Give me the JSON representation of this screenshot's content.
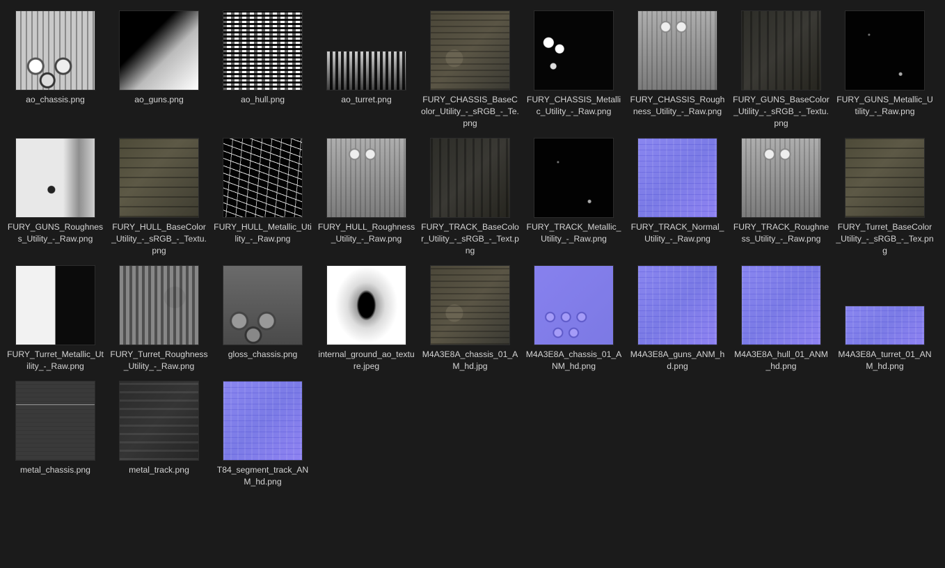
{
  "files": [
    {
      "name": "ao_chassis.png"
    },
    {
      "name": "ao_guns.png"
    },
    {
      "name": "ao_hull.png"
    },
    {
      "name": "ao_turret.png"
    },
    {
      "name": "FURY_CHASSIS_BaseColor_Utility_-_sRGB_-_Te.png"
    },
    {
      "name": "FURY_CHASSIS_Metallic_Utility_-_Raw.png"
    },
    {
      "name": "FURY_CHASSIS_Roughness_Utility_-_Raw.png"
    },
    {
      "name": "FURY_GUNS_BaseColor_Utility_-_sRGB_-_Textu.png"
    },
    {
      "name": "FURY_GUNS_Metallic_Utility_-_Raw.png"
    },
    {
      "name": "FURY_GUNS_Roughness_Utility_-_Raw.png"
    },
    {
      "name": "FURY_HULL_BaseColor_Utility_-_sRGB_-_Textu.png"
    },
    {
      "name": "FURY_HULL_Metallic_Utility_-_Raw.png"
    },
    {
      "name": "FURY_HULL_Roughness_Utility_-_Raw.png"
    },
    {
      "name": "FURY_TRACK_BaseColor_Utility_-_sRGB_-_Text.png"
    },
    {
      "name": "FURY_TRACK_Metallic_Utility_-_Raw.png"
    },
    {
      "name": "FURY_TRACK_Normal_Utility_-_Raw.png"
    },
    {
      "name": "FURY_TRACK_Roughness_Utility_-_Raw.png"
    },
    {
      "name": "FURY_Turret_BaseColor_Utility_-_sRGB_-_Tex.png"
    },
    {
      "name": "FURY_Turret_Metallic_Utility_-_Raw.png"
    },
    {
      "name": "FURY_Turret_Roughness_Utility_-_Raw.png"
    },
    {
      "name": "gloss_chassis.png"
    },
    {
      "name": "internal_ground_ao_texture.jpeg"
    },
    {
      "name": "M4A3E8A_chassis_01_AM_hd.jpg"
    },
    {
      "name": "M4A3E8A_chassis_01_ANM_hd.png"
    },
    {
      "name": "M4A3E8A_guns_ANM_hd.png"
    },
    {
      "name": "M4A3E8A_hull_01_ANM_hd.png"
    },
    {
      "name": "M4A3E8A_turret_01_ANM_hd.png"
    },
    {
      "name": "metal_chassis.png"
    },
    {
      "name": "metal_track.png"
    },
    {
      "name": "T84_segment_track_ANM_hd.png"
    }
  ]
}
